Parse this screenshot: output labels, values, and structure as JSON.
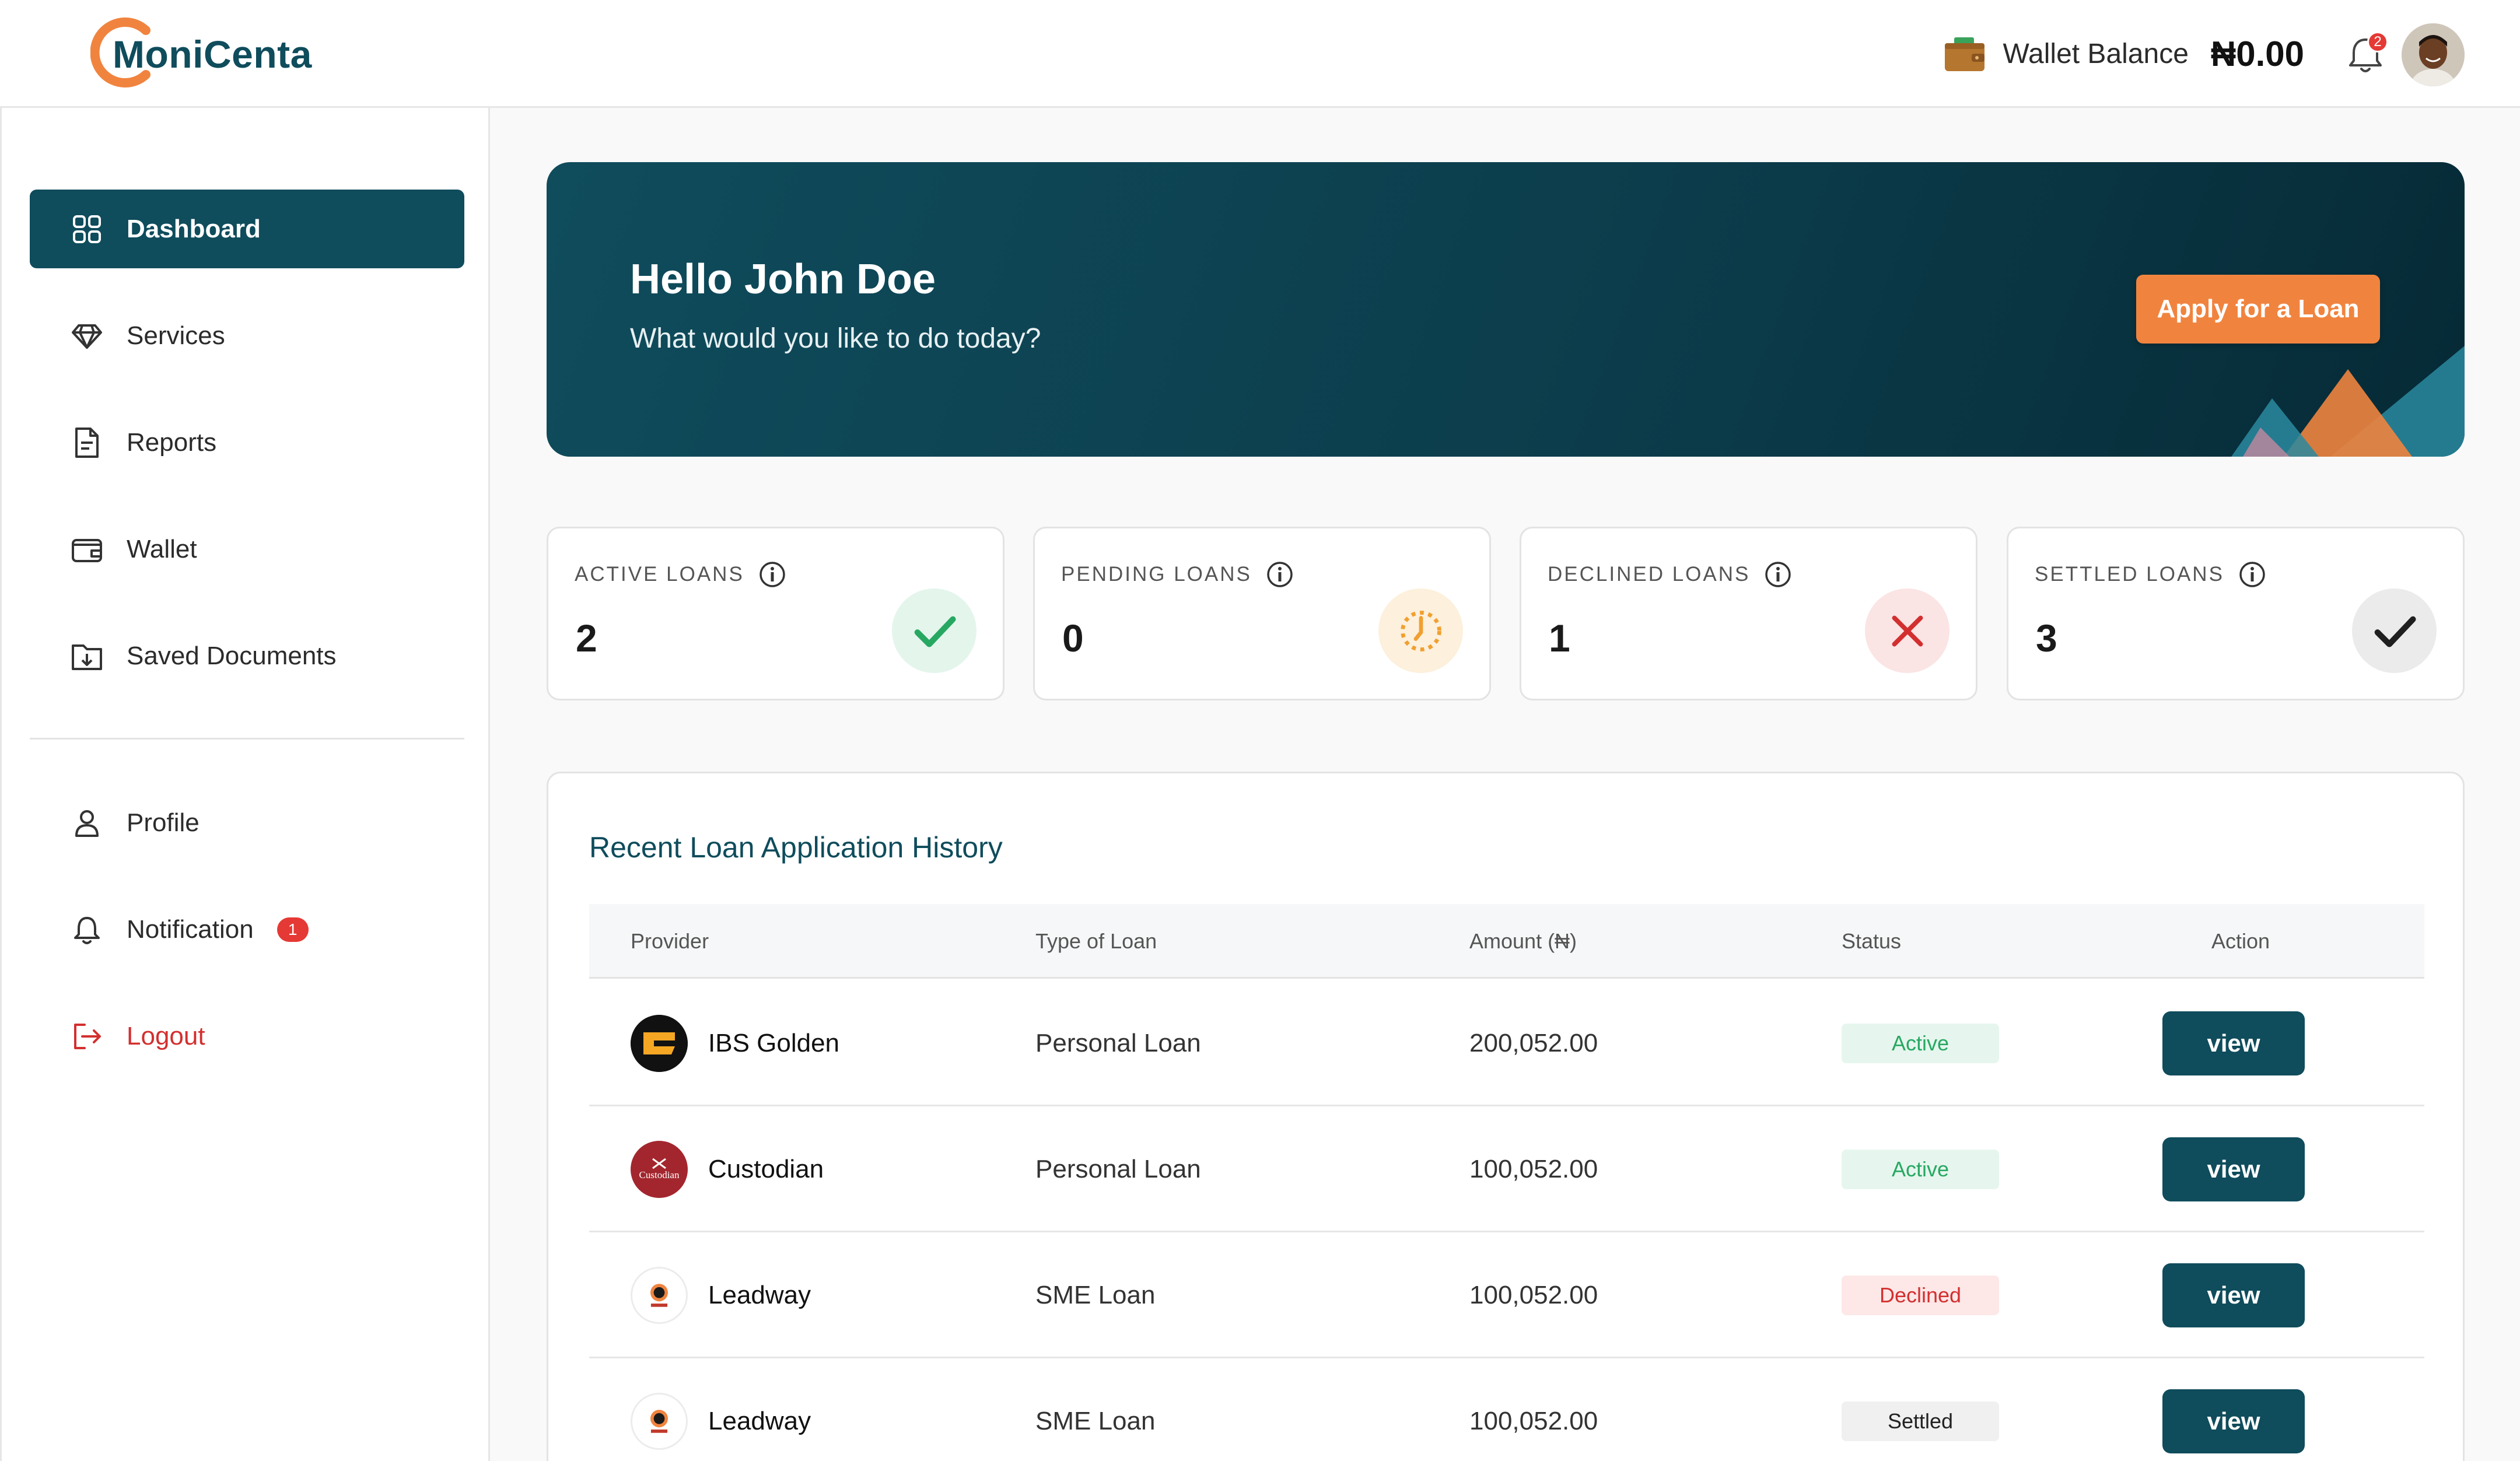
{
  "header": {
    "brand": "MoniCenta",
    "wallet_label": "Wallet Balance",
    "wallet_amount": "₦0.00",
    "notification_count": "2",
    "wallet_icon": "wallet-icon",
    "bell_icon": "bell-icon"
  },
  "sidebar": {
    "items": [
      {
        "label": "Dashboard",
        "icon": "grid-icon",
        "active": true
      },
      {
        "label": "Services",
        "icon": "diamond-icon"
      },
      {
        "label": "Reports",
        "icon": "document-icon"
      },
      {
        "label": "Wallet",
        "icon": "wallet-icon"
      },
      {
        "label": "Saved Documents",
        "icon": "folder-download-icon"
      }
    ],
    "bottom_items": [
      {
        "label": "Profile",
        "icon": "user-icon"
      },
      {
        "label": "Notification",
        "icon": "bell-icon",
        "badge": "1"
      },
      {
        "label": "Logout",
        "icon": "logout-icon"
      }
    ]
  },
  "hero": {
    "greeting": "Hello John Doe",
    "subtitle": "What would you like to do today?",
    "cta": "Apply for a Loan"
  },
  "stats": [
    {
      "label": "ACTIVE LOANS",
      "value": "2",
      "icon": "check-icon",
      "color": "#27a862"
    },
    {
      "label": "PENDING LOANS",
      "value": "0",
      "icon": "clock-icon",
      "color": "#f0a030"
    },
    {
      "label": "DECLINED LOANS",
      "value": "1",
      "icon": "x-icon",
      "color": "#d32f2f"
    },
    {
      "label": "SETTLED LOANS",
      "value": "3",
      "icon": "check-icon",
      "color": "#222222"
    }
  ],
  "table": {
    "title": "Recent Loan Application History",
    "columns": [
      "Provider",
      "Type of Loan",
      "Amount (₦)",
      "Status",
      "Action"
    ],
    "rows": [
      {
        "provider": "IBS Golden",
        "type": "Personal Loan",
        "amount": "200,052.00",
        "status": "Active",
        "action": "view"
      },
      {
        "provider": "Custodian",
        "type": "Personal Loan",
        "amount": "100,052.00",
        "status": "Active",
        "action": "view"
      },
      {
        "provider": "Leadway",
        "type": "SME Loan",
        "amount": "100,052.00",
        "status": "Declined",
        "action": "view"
      },
      {
        "provider": "Leadway",
        "type": "SME Loan",
        "amount": "100,052.00",
        "status": "Settled",
        "action": "view"
      }
    ],
    "custodian_logo_text": "Custodian"
  },
  "colors": {
    "brand": "#0f4c5c",
    "accent": "#f0843f",
    "danger": "#e53935"
  }
}
